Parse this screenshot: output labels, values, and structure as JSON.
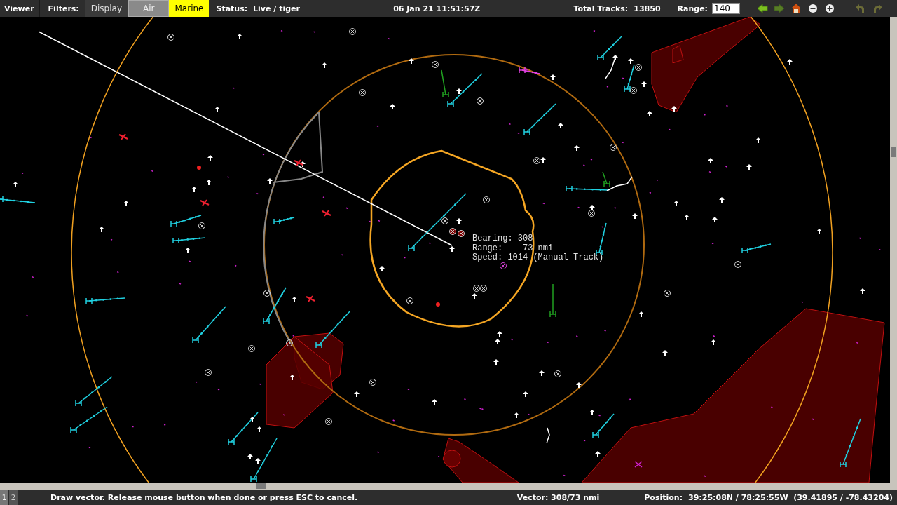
{
  "toolbar": {
    "menu": "Viewer",
    "filters_label": "Filters:",
    "filters": [
      {
        "label": "Display",
        "on": false,
        "dimmed": false
      },
      {
        "label": "Air",
        "on": false,
        "dimmed": true
      },
      {
        "label": "Marine",
        "on": true,
        "dimmed": false
      }
    ],
    "status_label": "Status:",
    "status": "Live / tiger",
    "datetime": "06 Jan 21 11:51:57Z",
    "total_tracks_label": "Total Tracks:",
    "total_tracks": "13850",
    "range_label": "Range:",
    "range_value": "140",
    "nav_buttons": [
      {
        "kind": "back",
        "disabled": false
      },
      {
        "kind": "forward",
        "disabled": true
      },
      {
        "kind": "home",
        "disabled": false
      },
      {
        "kind": "zoom-out",
        "disabled": false
      },
      {
        "kind": "zoom-in",
        "disabled": false
      },
      {
        "kind": "undo",
        "disabled": true
      },
      {
        "kind": "redo",
        "disabled": true
      }
    ]
  },
  "readout": [
    "Bearing: 308",
    "Range:    73 nmi",
    "Speed: 1014 (Manual Track)"
  ],
  "status_bar": {
    "pages": [
      {
        "label": "1",
        "selected": true
      },
      {
        "label": "2",
        "selected": false
      }
    ],
    "message": "Draw vector. Release mouse button when done or press ESC to cancel.",
    "vector": "Vector: 308/73 nmi",
    "position_label": "Position:",
    "position": "39:25:08N / 78:25:55W  (39.41895 / -78.43204)"
  }
}
